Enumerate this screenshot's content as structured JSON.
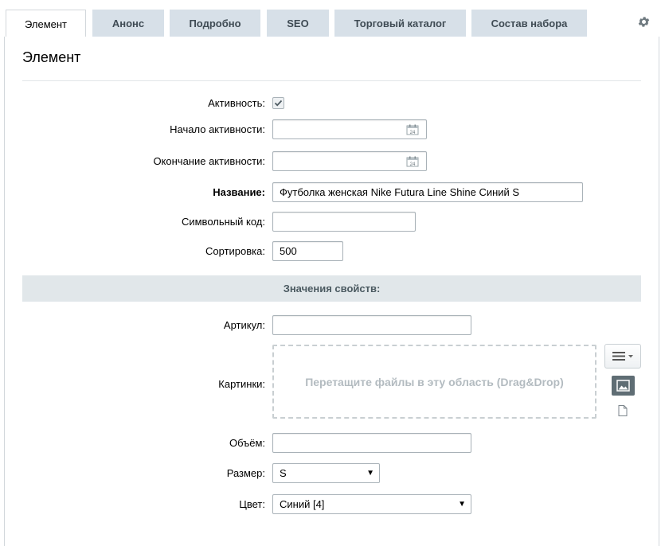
{
  "tabs": [
    {
      "label": "Элемент",
      "active": true
    },
    {
      "label": "Анонс",
      "active": false
    },
    {
      "label": "Подробно",
      "active": false
    },
    {
      "label": "SEO",
      "active": false
    },
    {
      "label": "Торговый каталог",
      "active": false
    },
    {
      "label": "Состав набора",
      "active": false
    }
  ],
  "section": {
    "title": "Элемент"
  },
  "fields": {
    "active": {
      "label": "Активность:",
      "checked": true
    },
    "active_from": {
      "label": "Начало активности:",
      "value": ""
    },
    "active_to": {
      "label": "Окончание активности:",
      "value": ""
    },
    "name": {
      "label": "Название:",
      "value": "Футболка женская Nike Futura Line Shine  Синий  S"
    },
    "code": {
      "label": "Символьный код:",
      "value": ""
    },
    "sort": {
      "label": "Сортировка:",
      "value": "500"
    }
  },
  "properties": {
    "header": "Значения свойств:",
    "article": {
      "label": "Артикул:",
      "value": ""
    },
    "pictures": {
      "label": "Картинки:",
      "dropzone_text": "Перетащите файлы в эту область (Drag&Drop)"
    },
    "volume": {
      "label": "Объём:",
      "value": ""
    },
    "size": {
      "label": "Размер:",
      "value": "S"
    },
    "color": {
      "label": "Цвет:",
      "value": "Синий [4]"
    }
  },
  "icons": {
    "settings": "gear-icon",
    "calendar": "calendar-icon",
    "menu": "menu-lines-icon",
    "image": "image-icon",
    "file": "file-icon"
  },
  "calendar_day": "24"
}
